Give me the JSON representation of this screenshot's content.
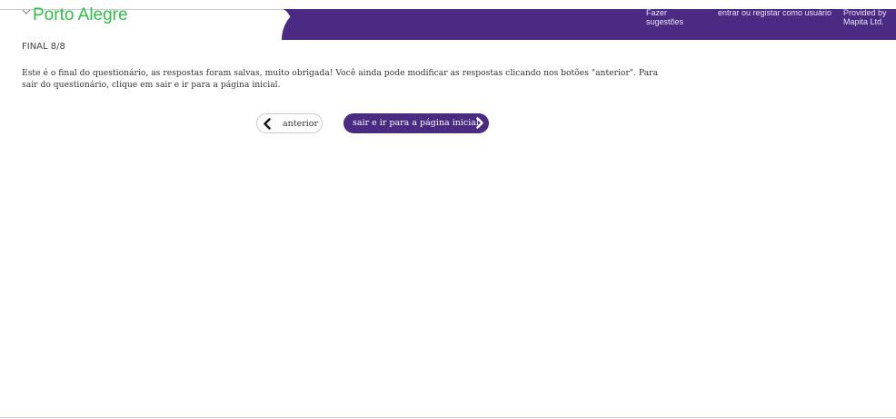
{
  "header": {
    "city_title": "Porto Alegre",
    "suggest_link": [
      "Fazer",
      "sugestões"
    ],
    "login_link": "entrar ou registar como usuário",
    "provided_by": [
      "Provided by",
      "Mapita Ltd."
    ],
    "band_color": "#4a2a82",
    "title_color": "#2fbf45",
    "chevron_icon": "chevron-down-icon"
  },
  "content": {
    "step_label": "FINAL 8/8",
    "message": "Este é o final do questionário, as respostas foram salvas, muito obrigada! Você ainda pode modificar as respostas clicando nos botões \"anterior\". Para sair do questionário, clique em sair e ir para a página inicial."
  },
  "navigation": {
    "prev_label": "anterior",
    "prev_icon": "chevron-left-icon",
    "next_label": "sair e ir para a página inicial",
    "next_icon": "chevron-right-icon",
    "next_color": "#4a2a82"
  }
}
